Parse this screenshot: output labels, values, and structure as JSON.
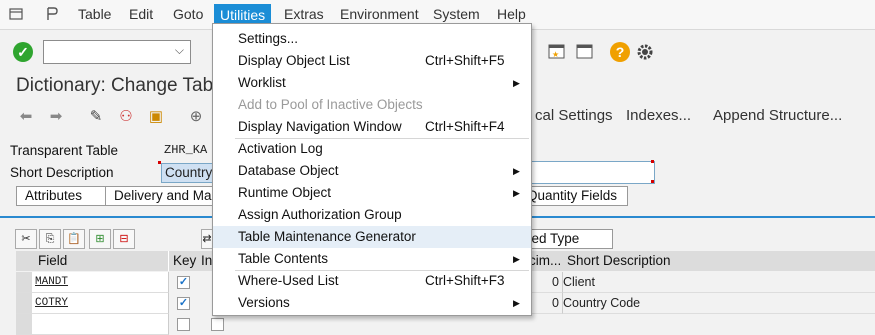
{
  "menubar": {
    "items": [
      "Table",
      "Edit",
      "Goto",
      "Utilities",
      "Extras",
      "Environment",
      "System",
      "Help"
    ],
    "active": "Utilities"
  },
  "page_title": "Dictionary: Change Table",
  "appbar": {
    "technical_settings": "cal Settings",
    "indexes": "Indexes...",
    "append_structure": "Append Structure..."
  },
  "header": {
    "transparent_table_label": "Transparent Table",
    "transparent_table_value": "ZHR_KA",
    "short_description_label": "Short Description",
    "short_description_value": "Country"
  },
  "tabs": [
    "Attributes",
    "Delivery and Mai",
    "Quantity Fields"
  ],
  "table_tabs": [
    "ned Type"
  ],
  "grid": {
    "columns": [
      "Field",
      "Key",
      "In",
      "cim...",
      "Short Description"
    ],
    "rows": [
      {
        "field": "MANDT",
        "key": true,
        "decimals": "0",
        "desc": "Client"
      },
      {
        "field": "COTRY",
        "key": true,
        "decimals": "0",
        "desc": "Country Code"
      },
      {
        "field": "",
        "key": false,
        "decimals": "",
        "desc": ""
      }
    ]
  },
  "utilities_menu": [
    {
      "label": "Settings...",
      "shortcut": "",
      "submenu": false,
      "disabled": false
    },
    {
      "label": "Display Object List",
      "shortcut": "Ctrl+Shift+F5",
      "submenu": false,
      "disabled": false
    },
    {
      "label": "Worklist",
      "shortcut": "",
      "submenu": true,
      "disabled": false
    },
    {
      "label": "Add to Pool of Inactive Objects",
      "shortcut": "",
      "submenu": false,
      "disabled": true
    },
    {
      "label": "Display Navigation Window",
      "shortcut": "Ctrl+Shift+F4",
      "submenu": false,
      "disabled": false
    },
    {
      "label": "Activation Log",
      "shortcut": "",
      "submenu": false,
      "disabled": false
    },
    {
      "label": "Database Object",
      "shortcut": "",
      "submenu": true,
      "disabled": false
    },
    {
      "label": "Runtime Object",
      "shortcut": "",
      "submenu": true,
      "disabled": false
    },
    {
      "label": "Assign Authorization Group",
      "shortcut": "",
      "submenu": false,
      "disabled": false
    },
    {
      "label": "Table Maintenance Generator",
      "shortcut": "",
      "submenu": false,
      "disabled": false,
      "highlighted": true
    },
    {
      "label": "Table Contents",
      "shortcut": "",
      "submenu": true,
      "disabled": false
    },
    {
      "label": "Where-Used List",
      "shortcut": "Ctrl+Shift+F3",
      "submenu": false,
      "disabled": false
    },
    {
      "label": "Versions",
      "shortcut": "",
      "submenu": true,
      "disabled": false
    }
  ]
}
